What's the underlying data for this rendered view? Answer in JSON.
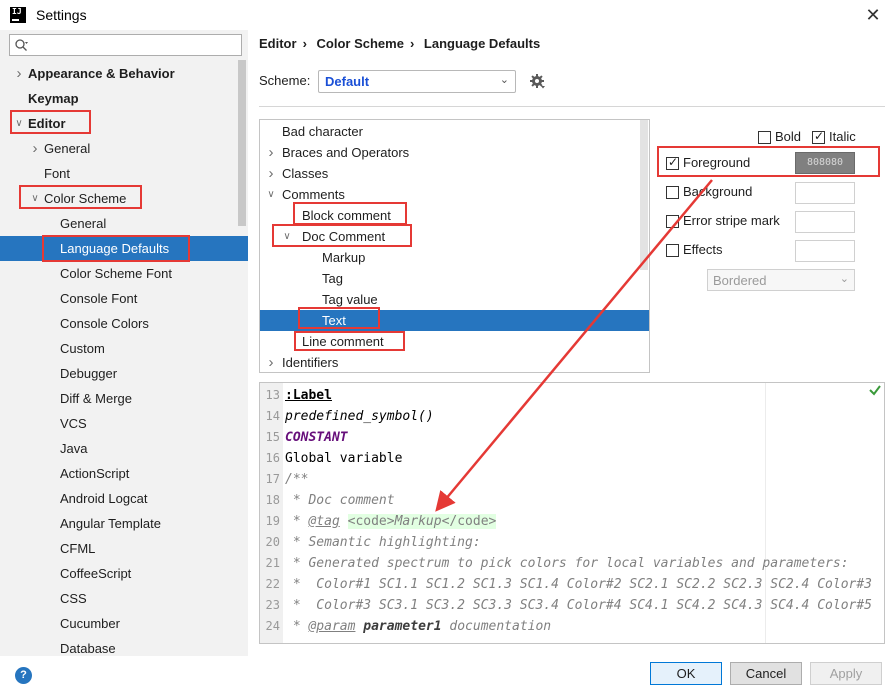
{
  "window": {
    "title": "Settings",
    "app_icon": "intellij-idea-icon",
    "close": "✕"
  },
  "search": {
    "placeholder": ""
  },
  "sidebar": {
    "items": [
      {
        "label": "Appearance & Behavior",
        "expand": "right"
      },
      {
        "label": "Keymap"
      },
      {
        "label": "Editor",
        "expand": "down"
      },
      {
        "label": "General",
        "expand": "right"
      },
      {
        "label": "Font"
      },
      {
        "label": "Color Scheme",
        "expand": "down"
      },
      {
        "label": "General"
      },
      {
        "label": "Language Defaults",
        "selected": true
      },
      {
        "label": "Color Scheme Font"
      },
      {
        "label": "Console Font"
      },
      {
        "label": "Console Colors"
      },
      {
        "label": "Custom"
      },
      {
        "label": "Debugger"
      },
      {
        "label": "Diff & Merge"
      },
      {
        "label": "VCS"
      },
      {
        "label": "Java"
      },
      {
        "label": "ActionScript"
      },
      {
        "label": "Android Logcat"
      },
      {
        "label": "Angular Template"
      },
      {
        "label": "CFML"
      },
      {
        "label": "CoffeeScript"
      },
      {
        "label": "CSS"
      },
      {
        "label": "Cucumber"
      },
      {
        "label": "Database"
      }
    ]
  },
  "breadcrumb": [
    "Editor",
    "Color Scheme",
    "Language Defaults"
  ],
  "breadcrumb_separator": "›",
  "scheme": {
    "label": "Scheme:",
    "value": "Default"
  },
  "element_tree": [
    {
      "label": "Bad character"
    },
    {
      "label": "Braces and Operators",
      "expand": "right"
    },
    {
      "label": "Classes",
      "expand": "right"
    },
    {
      "label": "Comments",
      "expand": "down"
    },
    {
      "label": "Block comment"
    },
    {
      "label": "Doc Comment",
      "expand": "down"
    },
    {
      "label": "Markup"
    },
    {
      "label": "Tag"
    },
    {
      "label": "Tag value"
    },
    {
      "label": "Text",
      "selected": true
    },
    {
      "label": "Line comment"
    },
    {
      "label": "Identifiers",
      "expand": "right"
    }
  ],
  "attributes": {
    "bold": {
      "label": "Bold",
      "checked": false
    },
    "italic": {
      "label": "Italic",
      "checked": true
    },
    "foreground": {
      "label": "Foreground",
      "checked": true,
      "value": "808080",
      "color": "#808080"
    },
    "background": {
      "label": "Background",
      "checked": false
    },
    "error_stripe": {
      "label": "Error stripe mark",
      "checked": false
    },
    "effects": {
      "label": "Effects",
      "checked": false,
      "select_value": "Bordered"
    }
  },
  "preview": {
    "lines": [
      {
        "n": "13",
        "text": ":Label"
      },
      {
        "n": "14",
        "text": "predefined_symbol()"
      },
      {
        "n": "15",
        "text": "CONSTANT"
      },
      {
        "n": "16",
        "text": "Global variable"
      },
      {
        "n": "17",
        "text": "/**"
      },
      {
        "n": "18",
        "text": " * Doc comment"
      },
      {
        "n": "19",
        "pre": " * ",
        "tag": "@tag",
        "markup_open": "<code>",
        "markup_text": "Markup",
        "markup_close": "</code>"
      },
      {
        "n": "20",
        "text": " * Semantic highlighting:"
      },
      {
        "n": "21",
        "text": " * Generated spectrum to pick colors for local variables and parameters:"
      },
      {
        "n": "22",
        "text": " *  Color#1 SC1.1 SC1.2 SC1.3 SC1.4 Color#2 SC2.1 SC2.2 SC2.3 SC2.4 Color#3"
      },
      {
        "n": "23",
        "text": " *  Color#3 SC3.1 SC3.2 SC3.3 SC3.4 Color#4 SC4.1 SC4.2 SC4.3 SC4.4 Color#5"
      },
      {
        "n": "24",
        "pre": " * ",
        "tag": "@param",
        "param": "parameter1",
        "rest": " documentation"
      }
    ]
  },
  "footer": {
    "help": "?",
    "ok": "OK",
    "cancel": "Cancel",
    "apply": "Apply"
  },
  "colors": {
    "selection": "#2675bf",
    "annotation": "#e53935",
    "scheme_text": "#1a4fd6"
  }
}
